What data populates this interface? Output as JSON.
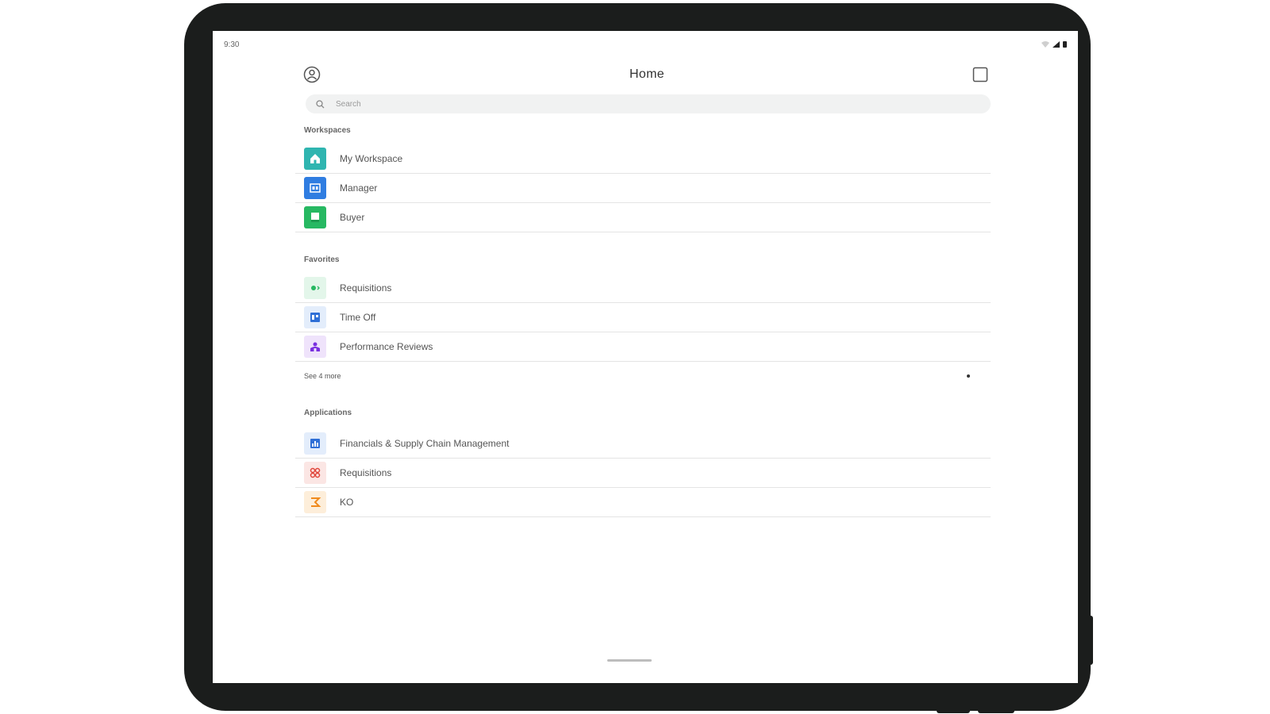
{
  "status_bar": {
    "time": "9:30"
  },
  "header": {
    "title": "Home"
  },
  "search": {
    "placeholder": "Search"
  },
  "workspaces": {
    "label": "Workspaces",
    "items": [
      {
        "label": "My Workspace",
        "icon": "home-icon",
        "color": "#2fb5b0"
      },
      {
        "label": "Manager",
        "icon": "manager-icon",
        "color": "#2f7de1"
      },
      {
        "label": "Buyer",
        "icon": "buyer-icon",
        "color": "#27b862"
      }
    ]
  },
  "favorites": {
    "label": "Favorites",
    "items": [
      {
        "label": "Requisitions",
        "icon": "requisitions-icon",
        "color": "#27b862"
      },
      {
        "label": "Time Off",
        "icon": "time-off-icon",
        "color": "#2f6fd6"
      },
      {
        "label": "Performance Reviews",
        "icon": "performance-reviews-icon",
        "color": "#7a2fe0"
      }
    ],
    "see_more": "See 4 more"
  },
  "applications": {
    "label": "Applications",
    "items": [
      {
        "label": "Financials & Supply Chain Management",
        "icon": "financials-icon",
        "color": "#2f6fd6"
      },
      {
        "label": "Requisitions",
        "icon": "requisitions-app-icon",
        "color": "#e0453a"
      },
      {
        "label": "KO",
        "icon": "ko-icon",
        "color": "#f08a1c"
      }
    ]
  }
}
